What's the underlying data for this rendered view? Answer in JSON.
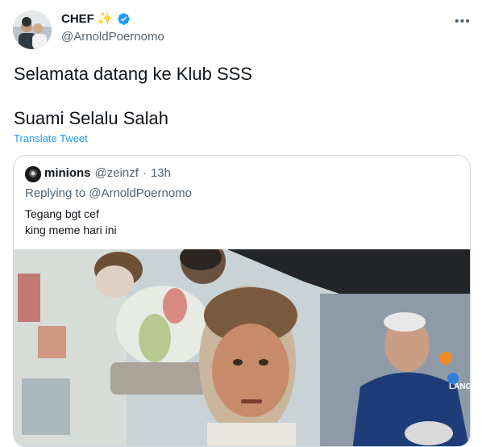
{
  "tweet": {
    "display_name": "CHEF",
    "handle": "@ArnoldPoernomo",
    "text_line1": "Selamata datang ke Klub SSS",
    "text_line2": "Suami Selalu Salah",
    "translate_label": "Translate Tweet",
    "more_icon": "more-horizontal-icon",
    "name_emoji": "✨",
    "accent_color": "#1d9bf0"
  },
  "quoted": {
    "display_name": "minions",
    "handle": "@zeinzf",
    "separator": "·",
    "time": "13h",
    "reply_line": "Replying to @ArnoldPoernomo",
    "text_line1": "Tegang bgt cef",
    "text_line2": "king meme hari ini",
    "media_overlay_text": "LANGS"
  }
}
